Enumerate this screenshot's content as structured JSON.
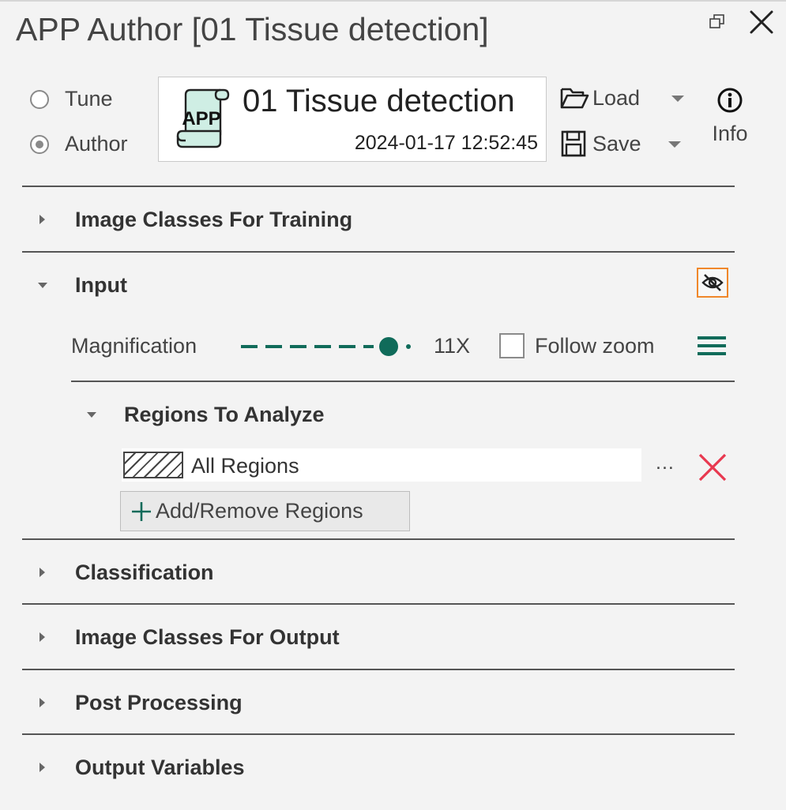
{
  "window": {
    "title": "APP Author [01 Tissue detection]"
  },
  "mode": {
    "options": [
      {
        "label": "Tune",
        "selected": false
      },
      {
        "label": "Author",
        "selected": true
      }
    ]
  },
  "app": {
    "icon_text": "APP",
    "name": "01 Tissue detection",
    "timestamp": "2024-01-17 12:52:45"
  },
  "toolbar": {
    "load_label": "Load",
    "save_label": "Save",
    "info_label": "Info"
  },
  "sections": {
    "image_classes_training": "Image Classes For Training",
    "input": "Input",
    "classification": "Classification",
    "image_classes_output": "Image Classes For Output",
    "post_processing": "Post Processing",
    "output_variables": "Output Variables"
  },
  "input": {
    "magnification_label": "Magnification",
    "magnification_value": "11X",
    "follow_zoom_label": "Follow zoom",
    "follow_zoom_checked": false,
    "regions": {
      "header": "Regions To Analyze",
      "items": [
        {
          "label": "All Regions"
        }
      ],
      "more_label": "...",
      "add_remove_label": "Add/Remove Regions"
    }
  },
  "colors": {
    "accent_green": "#106b5a",
    "highlight_orange": "#f0872a",
    "delete_red": "#e8384f",
    "app_icon_fill": "#cfeee4"
  },
  "icons": {
    "restore": "restore-window-icon",
    "close": "close-icon",
    "load": "folder-open-icon",
    "save": "floppy-disk-icon",
    "info": "info-circle-icon",
    "visibility": "eye-slash-icon",
    "menu": "hamburger-menu-icon",
    "remove": "red-x-icon",
    "add": "plus-icon",
    "expand": "triangle-right-icon",
    "collapse": "triangle-down-icon"
  }
}
